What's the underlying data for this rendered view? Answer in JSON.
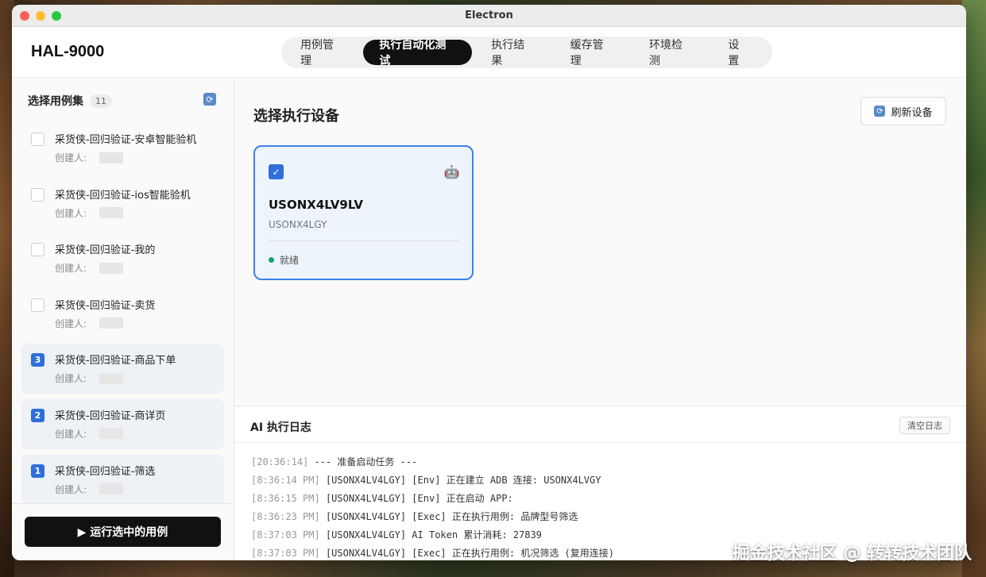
{
  "window": {
    "title": "Electron"
  },
  "app": {
    "title": "HAL-9000"
  },
  "nav": {
    "tabs": [
      "用例管理",
      "执行自动化测试",
      "执行结果",
      "缓存管理",
      "环境检测",
      "设置"
    ],
    "active_index": 1
  },
  "sidebar": {
    "title": "选择用例集",
    "count": "11",
    "creator_label": "创建人:",
    "items": [
      {
        "name": "采货侠-回归验证-安卓智能验机",
        "order": "",
        "selected": false
      },
      {
        "name": "采货侠-回归验证-ios智能验机",
        "order": "",
        "selected": false
      },
      {
        "name": "采货侠-回归验证-我的",
        "order": "",
        "selected": false
      },
      {
        "name": "采货侠-回归验证-卖货",
        "order": "",
        "selected": false
      },
      {
        "name": "采货侠-回归验证-商品下单",
        "order": "3",
        "selected": true
      },
      {
        "name": "采货侠-回归验证-商详页",
        "order": "2",
        "selected": true
      },
      {
        "name": "采货侠-回归验证-筛选",
        "order": "1",
        "selected": true
      }
    ],
    "run_button": "▶ 运行选中的用例"
  },
  "devices": {
    "title": "选择执行设备",
    "refresh_label": "刷新设备",
    "cards": [
      {
        "name": "USONX4LV9LV",
        "serial": "USONX4LGY",
        "status": "就绪",
        "checked": true
      }
    ]
  },
  "log": {
    "title": "AI 执行日志",
    "clear_label": "清空日志",
    "lines": [
      {
        "time": "[20:36:14]",
        "text": "--- 准备启动任务 ---"
      },
      {
        "time": "[8:36:14 PM]",
        "text": "[USONX4LV4LGY] [Env] 正在建立 ADB 连接: USONX4LVGY"
      },
      {
        "time": "[8:36:15 PM]",
        "text": "[USONX4LV4LGY] [Env] 正在启动 APP:"
      },
      {
        "time": "[8:36:23 PM]",
        "text": "[USONX4LV4LGY] [Exec] 正在执行用例: 品牌型号筛选"
      },
      {
        "time": "[8:37:03 PM]",
        "text": "[USONX4LV4LGY] AI Token 累计消耗: 27839"
      },
      {
        "time": "[8:37:03 PM]",
        "text": "[USONX4LV4LGY] [Exec] 正在执行用例: 机况筛选 (复用连接)"
      }
    ]
  },
  "watermark": "掘金技术社区 @ 转转技术团队",
  "colors": {
    "accent": "#2f6fdb",
    "active_tab": "#111111",
    "status_ready": "#1aa36a"
  }
}
